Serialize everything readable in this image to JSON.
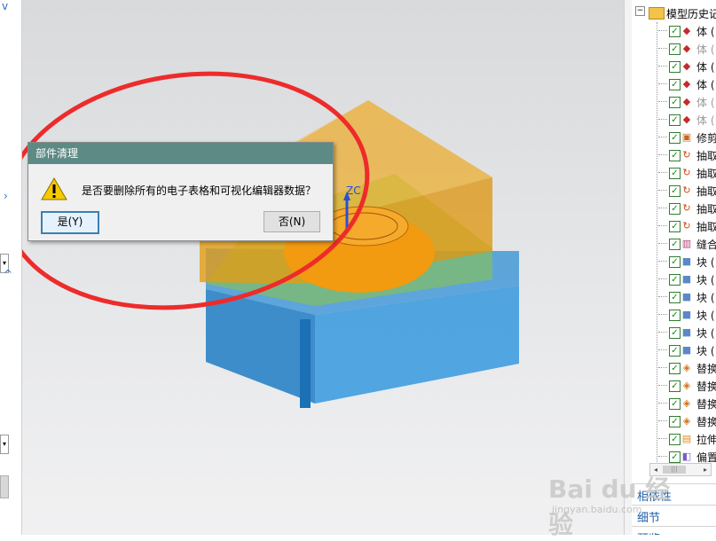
{
  "left_panel": {
    "chevron_top": "v",
    "chevron_mid": "^",
    "dropdown_glyph": "▾"
  },
  "dialog": {
    "title": "部件清理",
    "message": "是否要删除所有的电子表格和可视化编辑器数据？",
    "yes_label": "是(Y)",
    "no_label": "否(N)"
  },
  "viewport": {
    "axis_label": "ZC"
  },
  "tree": {
    "header": "模型历史记",
    "items": [
      {
        "label": "体 (",
        "dim": false,
        "icon": "body-icon"
      },
      {
        "label": "体 (",
        "dim": true,
        "icon": "body-icon"
      },
      {
        "label": "体 (",
        "dim": false,
        "icon": "body-icon"
      },
      {
        "label": "体 (",
        "dim": false,
        "icon": "body-icon"
      },
      {
        "label": "体 (",
        "dim": true,
        "icon": "body-icon"
      },
      {
        "label": "体 (",
        "dim": true,
        "icon": "body-icon"
      },
      {
        "label": "修剪",
        "dim": false,
        "icon": "trim-icon"
      },
      {
        "label": "抽取",
        "dim": false,
        "icon": "extract-icon"
      },
      {
        "label": "抽取",
        "dim": false,
        "icon": "extract-icon"
      },
      {
        "label": "抽取",
        "dim": false,
        "icon": "extract-icon"
      },
      {
        "label": "抽取",
        "dim": false,
        "icon": "extract-icon"
      },
      {
        "label": "抽取",
        "dim": false,
        "icon": "extract-icon"
      },
      {
        "label": "缝合",
        "dim": false,
        "icon": "sew-icon"
      },
      {
        "label": "块 (",
        "dim": false,
        "icon": "block-icon"
      },
      {
        "label": "块 (",
        "dim": false,
        "icon": "block-icon"
      },
      {
        "label": "块 (",
        "dim": false,
        "icon": "block-icon"
      },
      {
        "label": "块 (",
        "dim": false,
        "icon": "block-icon"
      },
      {
        "label": "块 (",
        "dim": false,
        "icon": "block-icon"
      },
      {
        "label": "块 (",
        "dim": false,
        "icon": "block-icon"
      },
      {
        "label": "替换",
        "dim": false,
        "icon": "replace-icon"
      },
      {
        "label": "替换",
        "dim": false,
        "icon": "replace-icon"
      },
      {
        "label": "替换",
        "dim": false,
        "icon": "replace-icon"
      },
      {
        "label": "替换",
        "dim": false,
        "icon": "replace-icon"
      },
      {
        "label": "拉伸",
        "dim": false,
        "icon": "extrude-icon"
      },
      {
        "label": "偏置",
        "dim": false,
        "icon": "offset-icon"
      }
    ],
    "scroll_thumb": "|||",
    "nav": [
      "相依性",
      "细节",
      "预览"
    ]
  },
  "watermark": {
    "brand": "Bai du 经验",
    "url": "jingyan.baidu.com"
  },
  "colors": {
    "dialog_title_bg": "#5d8a85",
    "annotation_red": "#ee2b2b",
    "check_green": "#128c12"
  }
}
